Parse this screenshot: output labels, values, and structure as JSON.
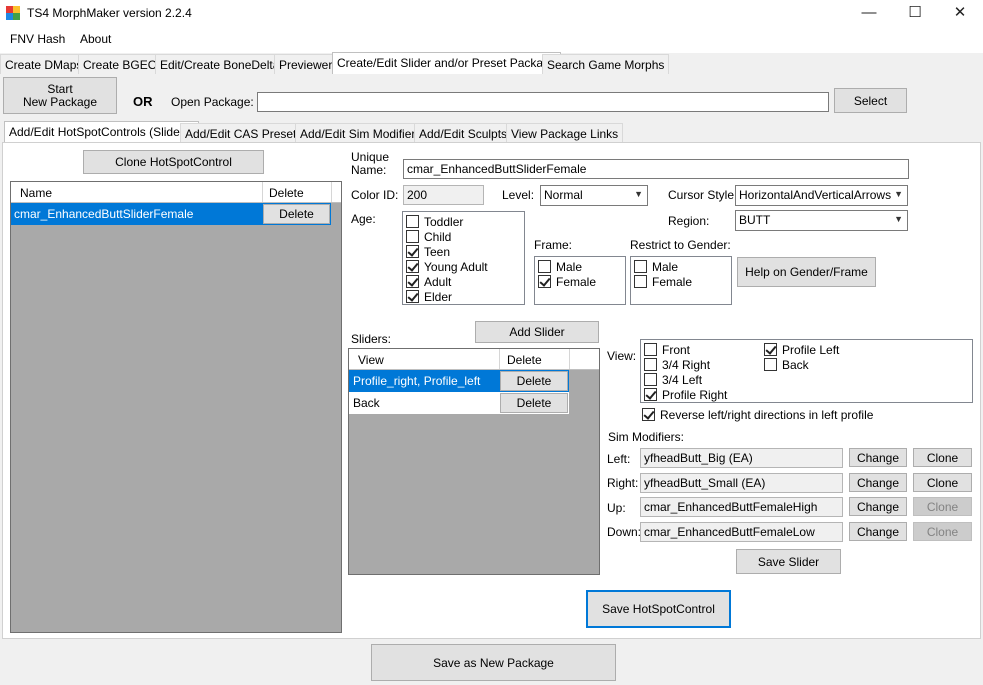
{
  "window": {
    "title": "TS4 MorphMaker version 2.2.4",
    "minimize": "—",
    "maximize": "☐",
    "close": "✕"
  },
  "menu": [
    "FNV Hash",
    "About"
  ],
  "main_tabs": [
    "Create DMaps",
    "Create BGEO",
    "Edit/Create BoneDelta",
    "Previewer",
    "Create/Edit Slider and/or Preset Package",
    "Search Game Morphs"
  ],
  "package": {
    "start_button": "Start\nNew Package",
    "or_label": "OR",
    "open_label": "Open Package:",
    "open_value": "",
    "select_button": "Select"
  },
  "sub_tabs": [
    "Add/Edit HotSpotControls (Sliders)",
    "Add/Edit CAS Presets",
    "Add/Edit Sim Modifiers",
    "Add/Edit Sculpts",
    "View Package Links"
  ],
  "hotspot": {
    "clone_button": "Clone HotSpotControl",
    "columns": [
      "Name",
      "Delete"
    ],
    "rows": [
      {
        "name": "cmar_EnhancedButtSliderFemale",
        "delete": "Delete"
      }
    ]
  },
  "form": {
    "unique_name_label": "Unique\nName:",
    "unique_name_value": "cmar_EnhancedButtSliderFemale",
    "color_id_label": "Color ID:",
    "color_id_value": "200",
    "level_label": "Level:",
    "level_value": "Normal",
    "cursor_label": "Cursor Style:",
    "cursor_value": "HorizontalAndVerticalArrows",
    "region_label": "Region:",
    "region_value": "BUTT",
    "age_label": "Age:",
    "ages": [
      {
        "label": "Toddler",
        "checked": false
      },
      {
        "label": "Child",
        "checked": false
      },
      {
        "label": "Teen",
        "checked": true
      },
      {
        "label": "Young Adult",
        "checked": true
      },
      {
        "label": "Adult",
        "checked": true
      },
      {
        "label": "Elder",
        "checked": true
      }
    ],
    "frame_label": "Frame:",
    "frames": [
      {
        "label": "Male",
        "checked": false
      },
      {
        "label": "Female",
        "checked": true
      }
    ],
    "gender_label": "Restrict to Gender:",
    "genders": [
      {
        "label": "Male",
        "checked": false
      },
      {
        "label": "Female",
        "checked": false
      }
    ],
    "help_button": "Help on Gender/Frame"
  },
  "sliders": {
    "label": "Sliders:",
    "add_button": "Add Slider",
    "columns": [
      "View",
      "Delete"
    ],
    "rows": [
      {
        "view": "Profile_right, Profile_left",
        "delete": "Delete",
        "selected": true
      },
      {
        "view": "Back",
        "delete": "Delete",
        "selected": false
      }
    ]
  },
  "view": {
    "label": "View:",
    "options_left": [
      {
        "label": "Front",
        "checked": false
      },
      {
        "label": "3/4 Right",
        "checked": false
      },
      {
        "label": "3/4 Left",
        "checked": false
      },
      {
        "label": "Profile Right",
        "checked": true
      }
    ],
    "options_right": [
      {
        "label": "Profile Left",
        "checked": true
      },
      {
        "label": "Back",
        "checked": false
      }
    ],
    "reverse_label": "Reverse left/right directions in left profile",
    "reverse_checked": true
  },
  "sim_modifiers": {
    "label": "Sim Modifiers:",
    "rows": [
      {
        "label": "Left:",
        "value": "yfheadButt_Big (EA)",
        "change": "Change",
        "clone": "Clone",
        "clone_enabled": true
      },
      {
        "label": "Right:",
        "value": "yfheadButt_Small (EA)",
        "change": "Change",
        "clone": "Clone",
        "clone_enabled": true
      },
      {
        "label": "Up:",
        "value": "cmar_EnhancedButtFemaleHigh",
        "change": "Change",
        "clone": "Clone",
        "clone_enabled": false
      },
      {
        "label": "Down:",
        "value": "cmar_EnhancedButtFemaleLow",
        "change": "Change",
        "clone": "Clone",
        "clone_enabled": false
      }
    ],
    "save_slider_button": "Save Slider"
  },
  "save_hotspot_button": "Save HotSpotControl",
  "save_package_button": "Save as New Package"
}
